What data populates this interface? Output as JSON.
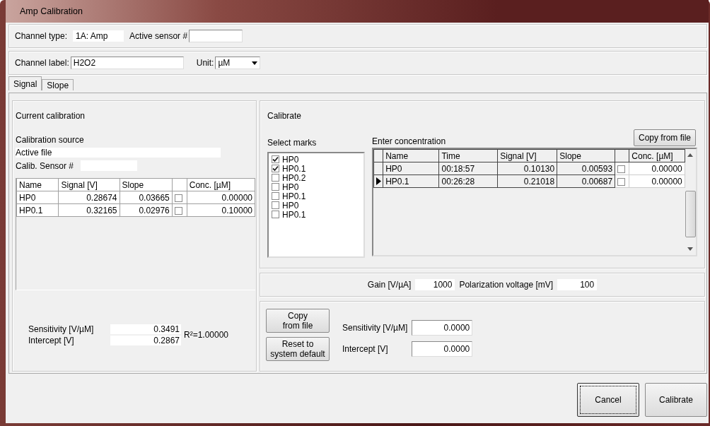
{
  "window": {
    "title": "Amp Calibration"
  },
  "channel": {
    "type_label": "Channel type:",
    "type_value": "1A: Amp",
    "sensor_label": "Active sensor #"
  },
  "label_row": {
    "label": "Channel label:",
    "value": "H2O2",
    "unit_label": "Unit:",
    "unit_value": "µM"
  },
  "tabs": [
    {
      "label": "Signal",
      "selected": true
    },
    {
      "label": "Slope",
      "selected": false
    }
  ],
  "current": {
    "title": "Current calibration",
    "source_label": "Calibration source",
    "source_value": "Active file",
    "sensor_label": "Calib. Sensor #",
    "columns": [
      "Name",
      "Signal [V]",
      "Slope",
      "Conc. [µM]"
    ],
    "rows": [
      {
        "name": "HP0",
        "signal": "0.28674",
        "slope": "0.03665",
        "checked": false,
        "conc": "0.00000"
      },
      {
        "name": "HP0.1",
        "signal": "0.32165",
        "slope": "0.02976",
        "checked": false,
        "conc": "0.10000"
      }
    ],
    "sensitivity_label": "Sensitivity [V/µM]",
    "sensitivity_value": "0.3491",
    "intercept_label": "Intercept [V]",
    "intercept_value": "0.2867",
    "r2": "R²=1.00000"
  },
  "calibrate": {
    "title": "Calibrate",
    "marks_label": "Select marks",
    "marks": [
      {
        "label": "HP0",
        "checked": true
      },
      {
        "label": "HP0.1",
        "checked": true
      },
      {
        "label": "HP0.2",
        "checked": false
      },
      {
        "label": "HP0",
        "checked": false
      },
      {
        "label": "HP0.1",
        "checked": false
      },
      {
        "label": "HP0",
        "checked": false
      },
      {
        "label": "HP0.1",
        "checked": false
      }
    ],
    "conc_label": "Enter concentration",
    "copy_button": "Copy from file",
    "columns": [
      "Name",
      "Time",
      "Signal [V]",
      "Slope",
      "Conc. [µM]"
    ],
    "rows": [
      {
        "name": "HP0",
        "time": "00:18:57",
        "signal": "0.10130",
        "slope": "0.00593",
        "checked": false,
        "conc": "0.00000",
        "selected": false
      },
      {
        "name": "HP0.1",
        "time": "00:26:28",
        "signal": "0.21018",
        "slope": "0.00687",
        "checked": false,
        "conc": "0.00000",
        "selected": true
      }
    ]
  },
  "gain": {
    "gain_label": "Gain [V/µA]",
    "gain_value": "1000",
    "pol_label": "Polarization voltage [mV]",
    "pol_value": "100"
  },
  "defaults": {
    "copy_button": "Copy\nfrom file",
    "reset_button": "Reset to\nsystem default",
    "sensitivity_label": "Sensitivity [V/µM]",
    "sensitivity_value": "0.0000",
    "intercept_label": "Intercept [V]",
    "intercept_value": "0.0000"
  },
  "buttons": [
    {
      "label": "Cancel",
      "focused": true
    },
    {
      "label": "Calibrate",
      "focused": false
    }
  ]
}
